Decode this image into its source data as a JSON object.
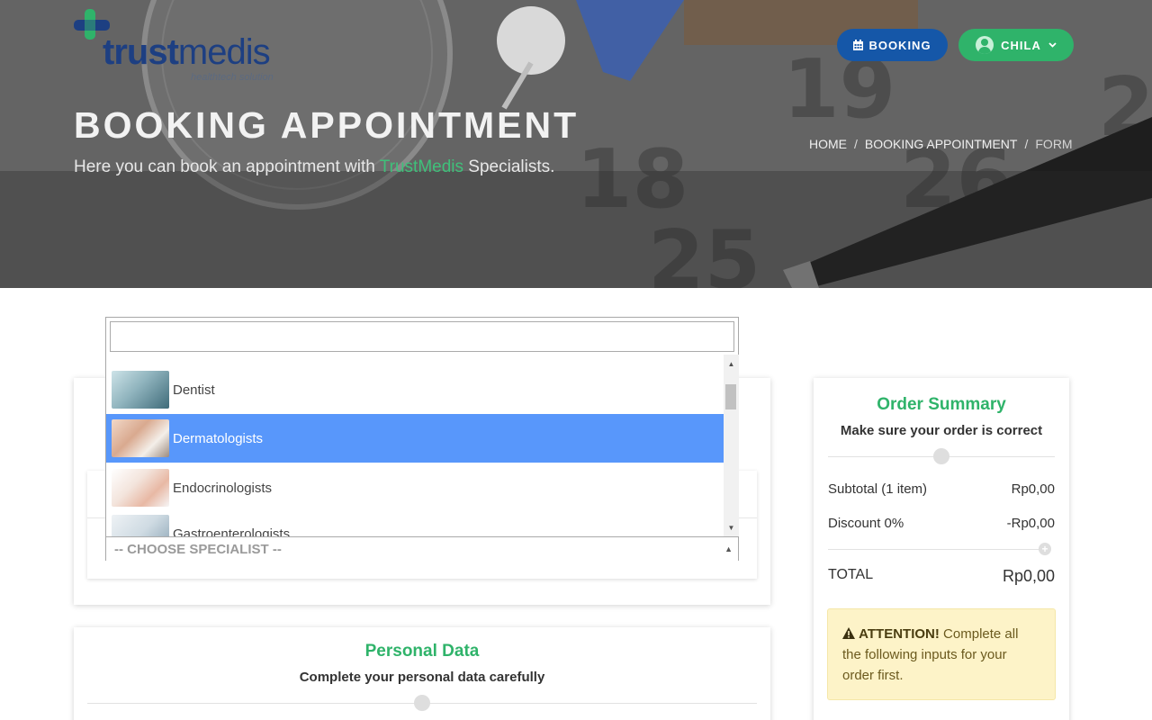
{
  "header": {
    "logo_text_bold": "trust",
    "logo_text_light": "medis",
    "logo_tagline": "healthtech solution",
    "booking_label": "BOOKING",
    "user_label": "CHILA",
    "title": "BOOKING APPOINTMENT",
    "subtitle_prefix": "Here you can book an appointment with ",
    "subtitle_highlight": "TrustMedis",
    "subtitle_suffix": " Specialists.",
    "breadcrumb": {
      "home": "HOME",
      "section": "BOOKING APPOINTMENT",
      "current": "FORM",
      "separator": "/"
    }
  },
  "specialist_dropdown": {
    "search_value": "",
    "selected_placeholder": "-- CHOOSE SPECIALIST --",
    "options": [
      {
        "label": "Dentist",
        "active": false
      },
      {
        "label": "Dermatologists",
        "active": true
      },
      {
        "label": "Endocrinologists",
        "active": false
      },
      {
        "label": "Gastroenterologists",
        "active": false
      }
    ]
  },
  "personal_data": {
    "title": "Personal Data",
    "subtitle": "Complete your personal data carefully"
  },
  "order_summary": {
    "title": "Order Summary",
    "subtitle": "Make sure your order is correct",
    "subtotal_label": "Subtotal (1 item)",
    "subtotal_value": "Rp0,00",
    "discount_label": "Discount 0%",
    "discount_value": "-Rp0,00",
    "total_label": "TOTAL",
    "total_value": "Rp0,00",
    "attention_label": "ATTENTION!",
    "attention_text": " Complete all the following inputs for your order first."
  },
  "colors": {
    "brand_green": "#2fb36a",
    "brand_blue": "#1557a8",
    "highlight_blue": "#5897fb",
    "attention_bg": "#fdf3c8"
  }
}
